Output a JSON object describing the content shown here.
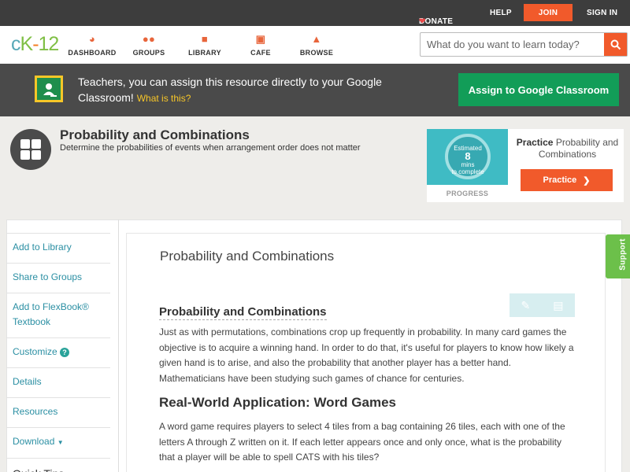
{
  "topbar": {
    "donate": "DONATE",
    "help": "HELP",
    "join": "JOIN",
    "signin": "SIGN IN"
  },
  "logo": {
    "text": "CK-12"
  },
  "nav": [
    {
      "label": "DASHBOARD",
      "icon": "dashboard-icon"
    },
    {
      "label": "GROUPS",
      "icon": "groups-icon"
    },
    {
      "label": "LIBRARY",
      "icon": "library-icon"
    },
    {
      "label": "CAFE",
      "icon": "cafe-icon"
    },
    {
      "label": "BROWSE",
      "icon": "browse-icon"
    }
  ],
  "search": {
    "placeholder": "What do you want to learn today?"
  },
  "google": {
    "text": "Teachers, you can assign this resource directly to your Google Classroom!",
    "what": "What is this?",
    "button": "Assign to Google Classroom"
  },
  "concept": {
    "title": "Probability and Combinations",
    "subtitle": "Determine the probabilities of events when arrangement order does not matter"
  },
  "practice": {
    "estimated": "Estimated",
    "mins": "8",
    "mins_label": "mins",
    "complete": "to complete",
    "progress": "PROGRESS",
    "bold": "Practice",
    "text": "Probability and Combinations",
    "button": "Practice"
  },
  "sidebar": {
    "items": [
      {
        "label": "Add to Library"
      },
      {
        "label": "Share to Groups"
      },
      {
        "label": "Add to FlexBook® Textbook"
      },
      {
        "label": "Customize"
      },
      {
        "label": "Details"
      },
      {
        "label": "Resources"
      },
      {
        "label": "Download"
      }
    ],
    "quick_tips": "Quick Tips"
  },
  "article": {
    "title": "Probability and Combinations",
    "heading1": "Probability and Combinations",
    "para1": "Just as with permutations, combinations crop up frequently in probability. In many card games the objective is to acquire a winning hand. In order to do that, it's useful for players to know how likely a given hand is to arise, and also the probability that another player has a better hand. Mathematicians have been studying such games of chance for centuries.",
    "heading2": "Real-World Application: Word Games",
    "para2": "A word game requires players to select 4 tiles from a bag containing 26 tiles, each with one of the letters A through Z written on it. If each letter appears once and only once, what is the probability that a player will be able to spell CATS with his tiles?"
  },
  "support": "Support",
  "colors": {
    "accent": "#f15a2b",
    "google_green": "#129d58",
    "support_green": "#6cc04a",
    "link": "#2b8fa3"
  }
}
